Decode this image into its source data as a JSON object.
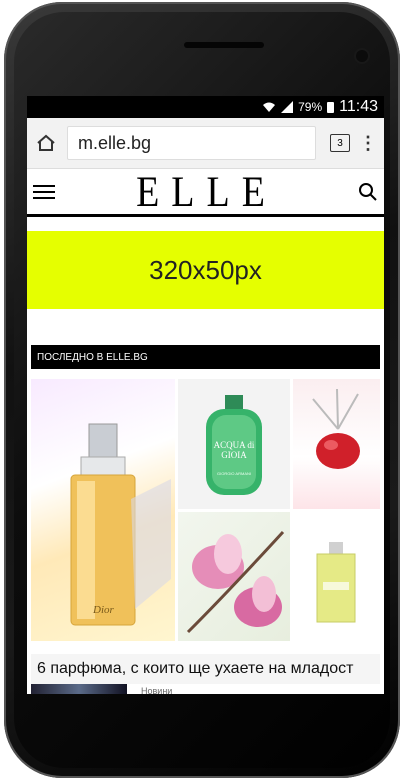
{
  "status_bar": {
    "battery": "79%",
    "time": "11:43"
  },
  "browser": {
    "url": "m.elle.bg",
    "tab_count": "3"
  },
  "site": {
    "logo": "ELLE"
  },
  "ad": {
    "label": "320x50px"
  },
  "section": {
    "title": "ПОСЛЕДНО В ELLE.BG"
  },
  "article": {
    "title": "6 парфюма, с които ще ухаете на младост",
    "perfume_labels": {
      "giorgio": "ACQUA di GIOIA",
      "giorgio_brand": "GIORGIO ARMANI",
      "dior": "Dior"
    }
  },
  "next_article": {
    "category": "Новини"
  },
  "colors": {
    "ad_background": "#e5ff00",
    "section_bar": "#000000"
  }
}
